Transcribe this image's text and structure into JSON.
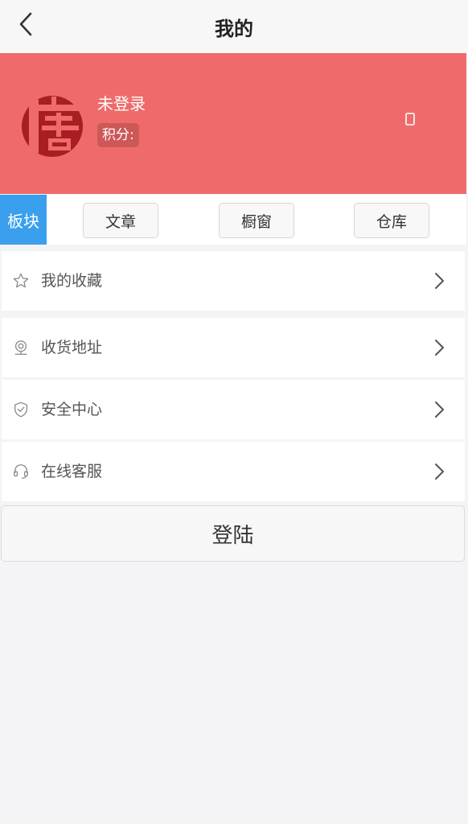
{
  "header": {
    "title": "我的",
    "back_icon": "chevron-left-icon"
  },
  "profile": {
    "avatar_icon": "tang-logo-icon",
    "name": "未登录",
    "points_label": "积分:",
    "message_icon": "message-icon",
    "banner_color": "#ef6b6b"
  },
  "tabs": {
    "active": "板块",
    "items": [
      "文章",
      "橱窗",
      "仓库"
    ],
    "active_color": "#3aa0ee"
  },
  "menu": [
    {
      "label": "我的收藏",
      "icon": "star-icon"
    },
    {
      "label": "收货地址",
      "icon": "location-icon"
    },
    {
      "label": "安全中心",
      "icon": "shield-icon"
    },
    {
      "label": "在线客服",
      "icon": "headset-icon"
    }
  ],
  "login": {
    "label": "登陆"
  }
}
